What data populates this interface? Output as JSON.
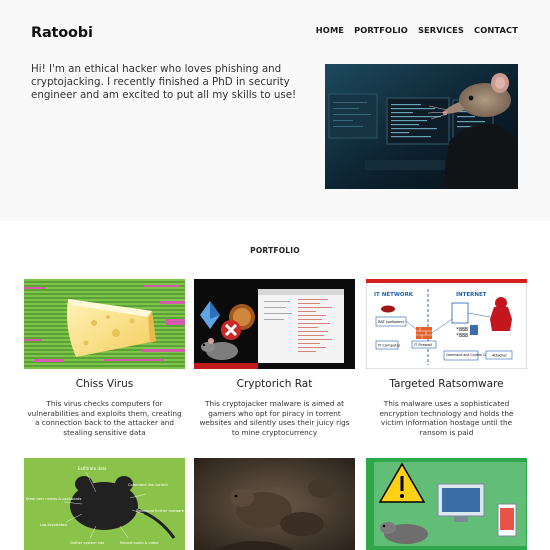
{
  "header": {
    "brand": "Ratoobi",
    "nav": [
      "HOME",
      "PORTFOLIO",
      "SERVICES",
      "CONTACT"
    ]
  },
  "intro": {
    "text": "Hi! I'm an ethical hacker who loves phishing and cryptojacking. I recently finished a PhD in security engineer and am excited to put all my skills to use!"
  },
  "portfolio": {
    "title": "PORTFOLIO",
    "projects": [
      {
        "title": "Chiss Virus",
        "description": "This virus checks computers for vulnerabilities and exploits them, creating a connection back to the attacker and stealing sensitive data"
      },
      {
        "title": "Cryptorich Rat",
        "description": "This cryptojacker malware is aimed at gamers who opt for piracy in torrent websites and silently uses their juicy rigs to mine cryptocurrency"
      },
      {
        "title": "Targeted Ratsomware",
        "description": "This malware uses a sophisticated encryption technology and holds the victim information hostage until the ransom is paid"
      }
    ],
    "diagram_labels": {
      "it_network": "IT NETWORK",
      "internet": "INTERNET",
      "rat_software": "RAT (software)",
      "it_computer": "IT Computer",
      "it_firewall": "IT Firewall",
      "command_control": "Command and Control Centre",
      "attacker": "Attacker"
    },
    "rat_labels": {
      "exfiltrate": "Exfiltrate data",
      "steal": "Steal user names & passwords",
      "command_line": "Command line control",
      "download": "Download further malware",
      "log": "Log keystrokes",
      "gather": "Gather system info",
      "record": "Record audio & video"
    }
  }
}
